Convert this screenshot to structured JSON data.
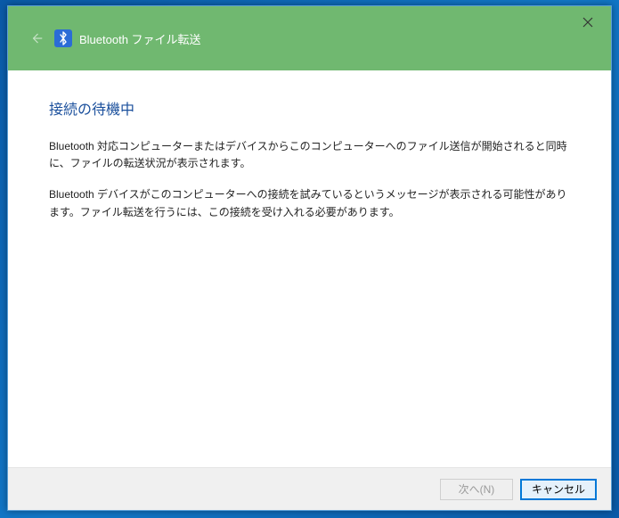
{
  "header": {
    "title": "Bluetooth ファイル転送"
  },
  "content": {
    "heading": "接続の待機中",
    "paragraph1": "Bluetooth 対応コンピューターまたはデバイスからこのコンピューターへのファイル送信が開始されると同時に、ファイルの転送状況が表示されます。",
    "paragraph2": "Bluetooth デバイスがこのコンピューターへの接続を試みているというメッセージが表示される可能性があります。ファイル転送を行うには、この接続を受け入れる必要があります。"
  },
  "footer": {
    "next_label": "次へ(N)",
    "cancel_label": "キャンセル"
  }
}
